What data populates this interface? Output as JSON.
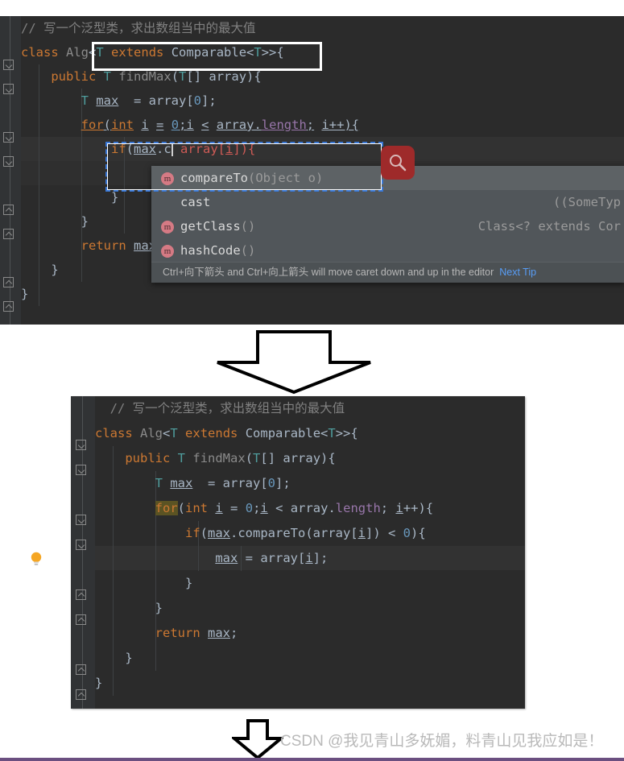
{
  "top_editor": {
    "name": "IntelliJ code editor with code-completion popup",
    "lines": [
      {
        "id": "l1",
        "text": "// 写一个泛型类，求出数组当中的最大值"
      },
      {
        "id": "l2",
        "text": "class Alg<T extends Comparable<T>>{"
      },
      {
        "id": "l3",
        "text": "    public T findMax(T[] array){"
      },
      {
        "id": "l4",
        "text": "        T max  = array[0];"
      },
      {
        "id": "l5",
        "text": "        for(int i = 0;i < array.length; i++){"
      },
      {
        "id": "l6",
        "text": "            if(max.c array[i]){"
      },
      {
        "id": "l7",
        "text": "            }"
      },
      {
        "id": "l8",
        "text": "        }"
      },
      {
        "id": "l9",
        "text": "        return max;"
      },
      {
        "id": "l10",
        "text": "    }"
      },
      {
        "id": "l11",
        "text": "}"
      }
    ],
    "caret_after": "max.c"
  },
  "completion_popup": {
    "items": [
      {
        "icon": "method-icon",
        "name": "compareTo",
        "signature": "(Object o)",
        "return_type": "",
        "selected": true
      },
      {
        "icon": "none",
        "name": "cast",
        "signature": "",
        "return_type": "((SomeTyp",
        "selected": false
      },
      {
        "icon": "method-icon",
        "name": "getClass",
        "signature": "()",
        "return_type": "Class<? extends Cor",
        "selected": false
      },
      {
        "icon": "method-icon",
        "name": "hashCode",
        "signature": "()",
        "return_type": "",
        "selected": false
      }
    ],
    "hint": "Ctrl+向下箭头 and Ctrl+向上箭头 will move caret down and up in the editor",
    "next_tip": "Next Tip"
  },
  "search_button": {
    "icon": "search-icon",
    "color": "#9e2a2a"
  },
  "annotations": {
    "generic_box_label": "highlight-rectangle-generic-bound",
    "dashed_box_label": "dashed-selection-rectangle",
    "arrow_big": "down-arrow-large",
    "arrow_small": "down-arrow-small"
  },
  "bottom_editor": {
    "name": "IntelliJ code editor after completion accepted",
    "lines": [
      {
        "id": "b1",
        "text": "// 写一个泛型类，求出数组当中的最大值"
      },
      {
        "id": "b2",
        "text": "class Alg<T extends Comparable<T>>{"
      },
      {
        "id": "b3",
        "text": "    public T findMax(T[] array){"
      },
      {
        "id": "b4",
        "text": "        T max  = array[0];"
      },
      {
        "id": "b5",
        "text": "        for(int i = 0;i < array.length; i++){"
      },
      {
        "id": "b6",
        "text": "            if(max.compareTo(array[i]) < 0){"
      },
      {
        "id": "b7",
        "text": "                max = array[i];"
      },
      {
        "id": "b8",
        "text": "            }"
      },
      {
        "id": "b9",
        "text": "        }"
      },
      {
        "id": "b10",
        "text": "        return max;"
      },
      {
        "id": "b11",
        "text": "    }"
      },
      {
        "id": "b12",
        "text": "}"
      }
    ],
    "bulb_icon": "lightbulb-icon"
  },
  "watermark": {
    "text": "CSDN @我见青山多妩媚，料青山见我应如是！"
  }
}
